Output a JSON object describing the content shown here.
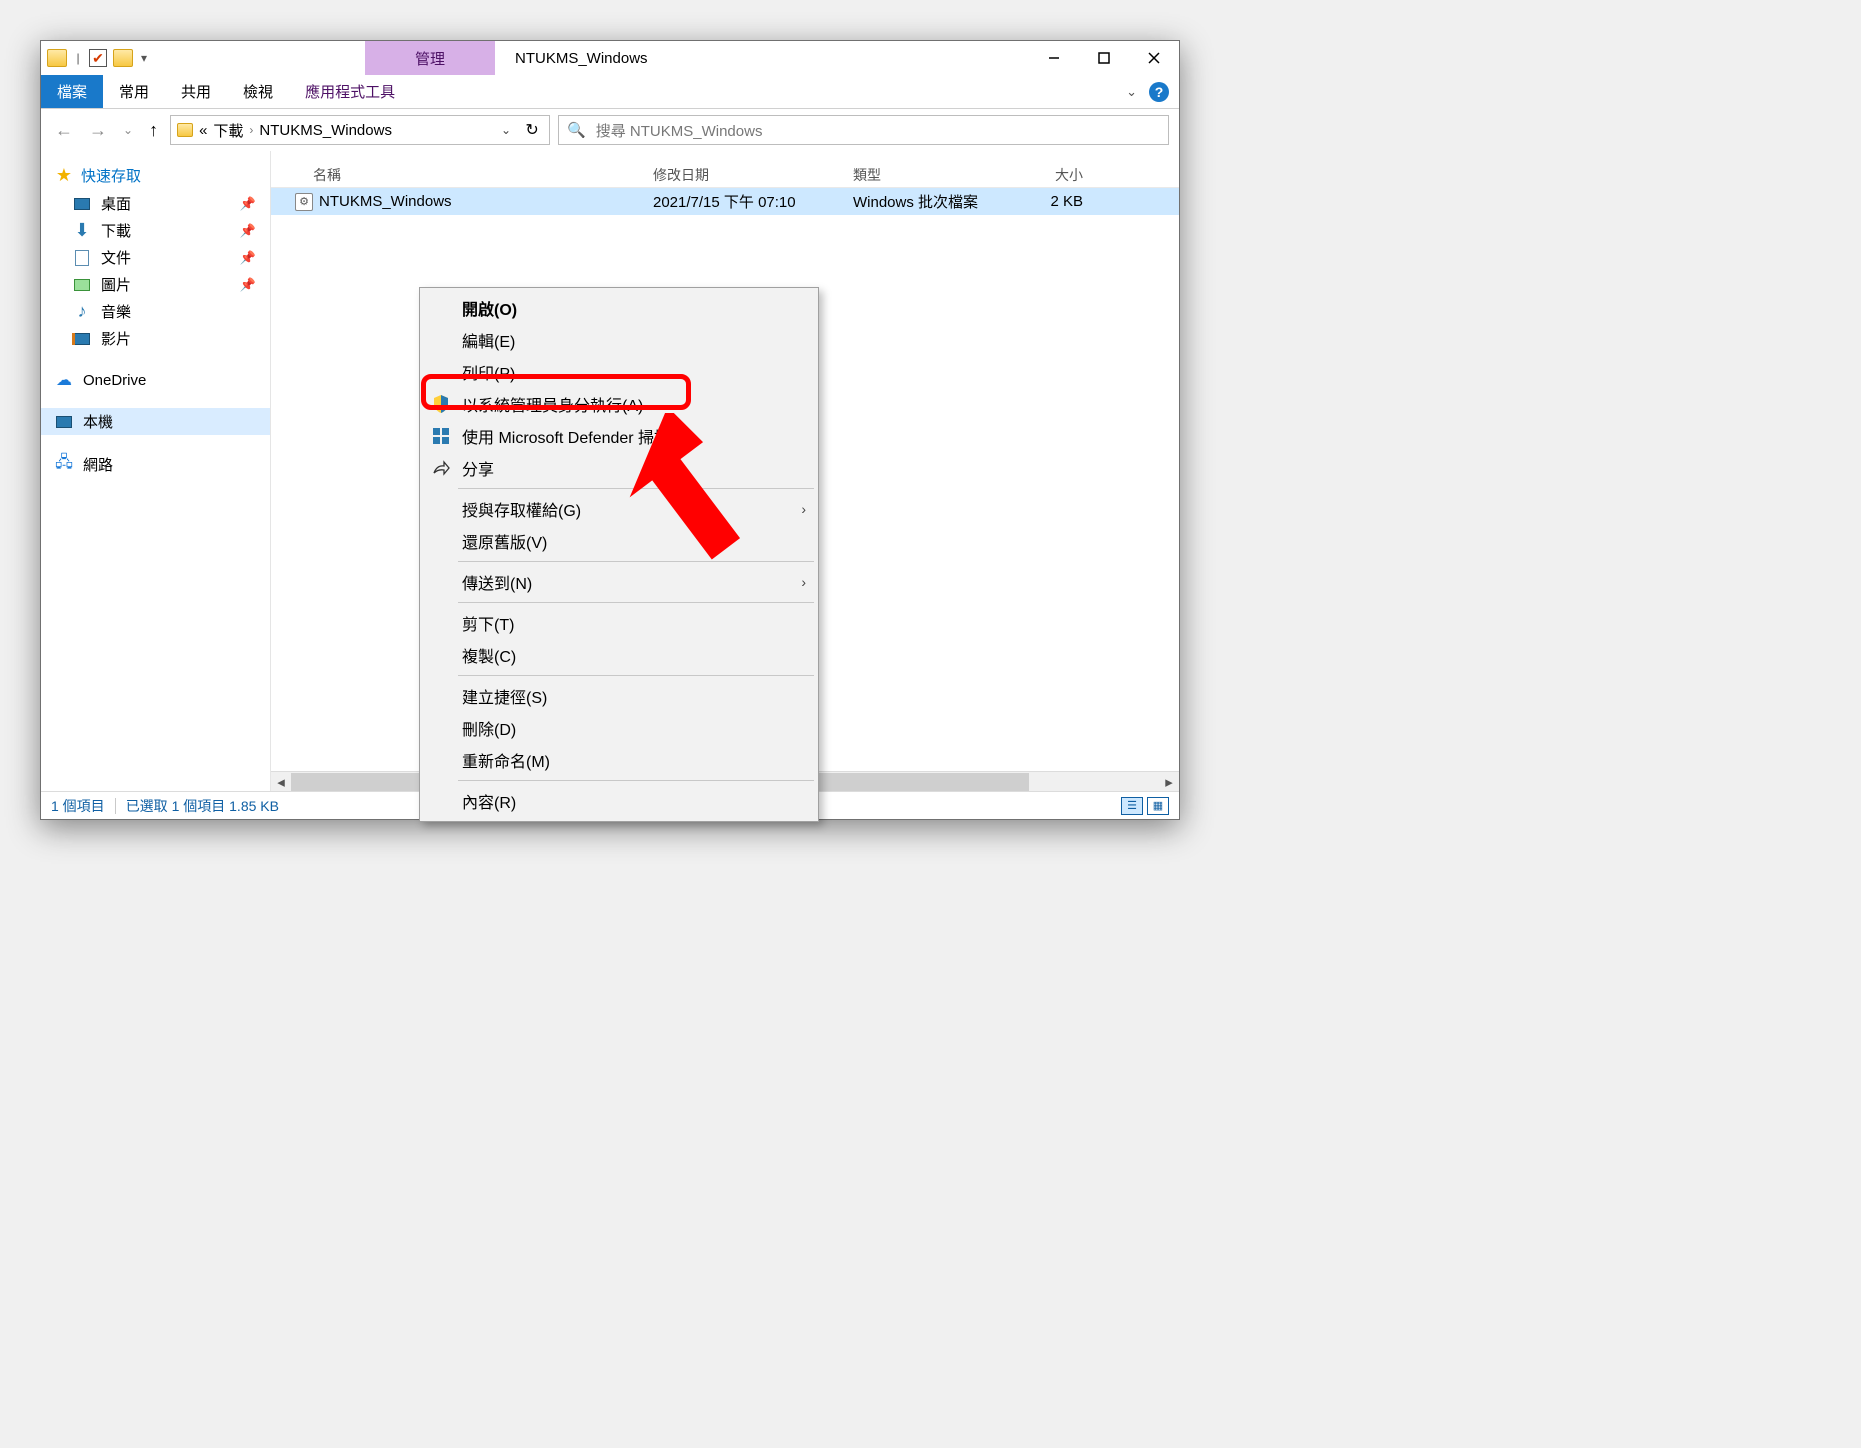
{
  "window_title": "NTUKMS_Windows",
  "ribbon_context_tab": "管理",
  "tabs": {
    "file": "檔案",
    "home": "常用",
    "share": "共用",
    "view": "檢視",
    "apptools": "應用程式工具"
  },
  "address": {
    "root_glyph": "«",
    "crumb1": "下載",
    "crumb2": "NTUKMS_Windows"
  },
  "search": {
    "placeholder": "搜尋 NTUKMS_Windows"
  },
  "sidebar": {
    "quick_access": "快速存取",
    "desktop": "桌面",
    "downloads": "下載",
    "documents": "文件",
    "pictures": "圖片",
    "music": "音樂",
    "videos": "影片",
    "onedrive": "OneDrive",
    "thispc": "本機",
    "network": "網路"
  },
  "columns": {
    "name": "名稱",
    "date": "修改日期",
    "type": "類型",
    "size": "大小"
  },
  "file": {
    "name": "NTUKMS_Windows",
    "date": "2021/7/15 下午 07:10",
    "type": "Windows 批次檔案",
    "size": "2 KB"
  },
  "context_menu": {
    "open": "開啟(O)",
    "edit": "編輯(E)",
    "print": "列印(P)",
    "run_as_admin": "以系統管理員身分執行(A)",
    "defender_scan": "使用 Microsoft Defender 掃描...",
    "share": "分享",
    "give_access": "授與存取權給(G)",
    "restore_prev": "還原舊版(V)",
    "send_to": "傳送到(N)",
    "cut": "剪下(T)",
    "copy": "複製(C)",
    "create_shortcut": "建立捷徑(S)",
    "delete": "刪除(D)",
    "rename": "重新命名(M)",
    "properties": "內容(R)"
  },
  "status": {
    "items": "1 個項目",
    "selected": "已選取 1 個項目 1.85 KB"
  }
}
